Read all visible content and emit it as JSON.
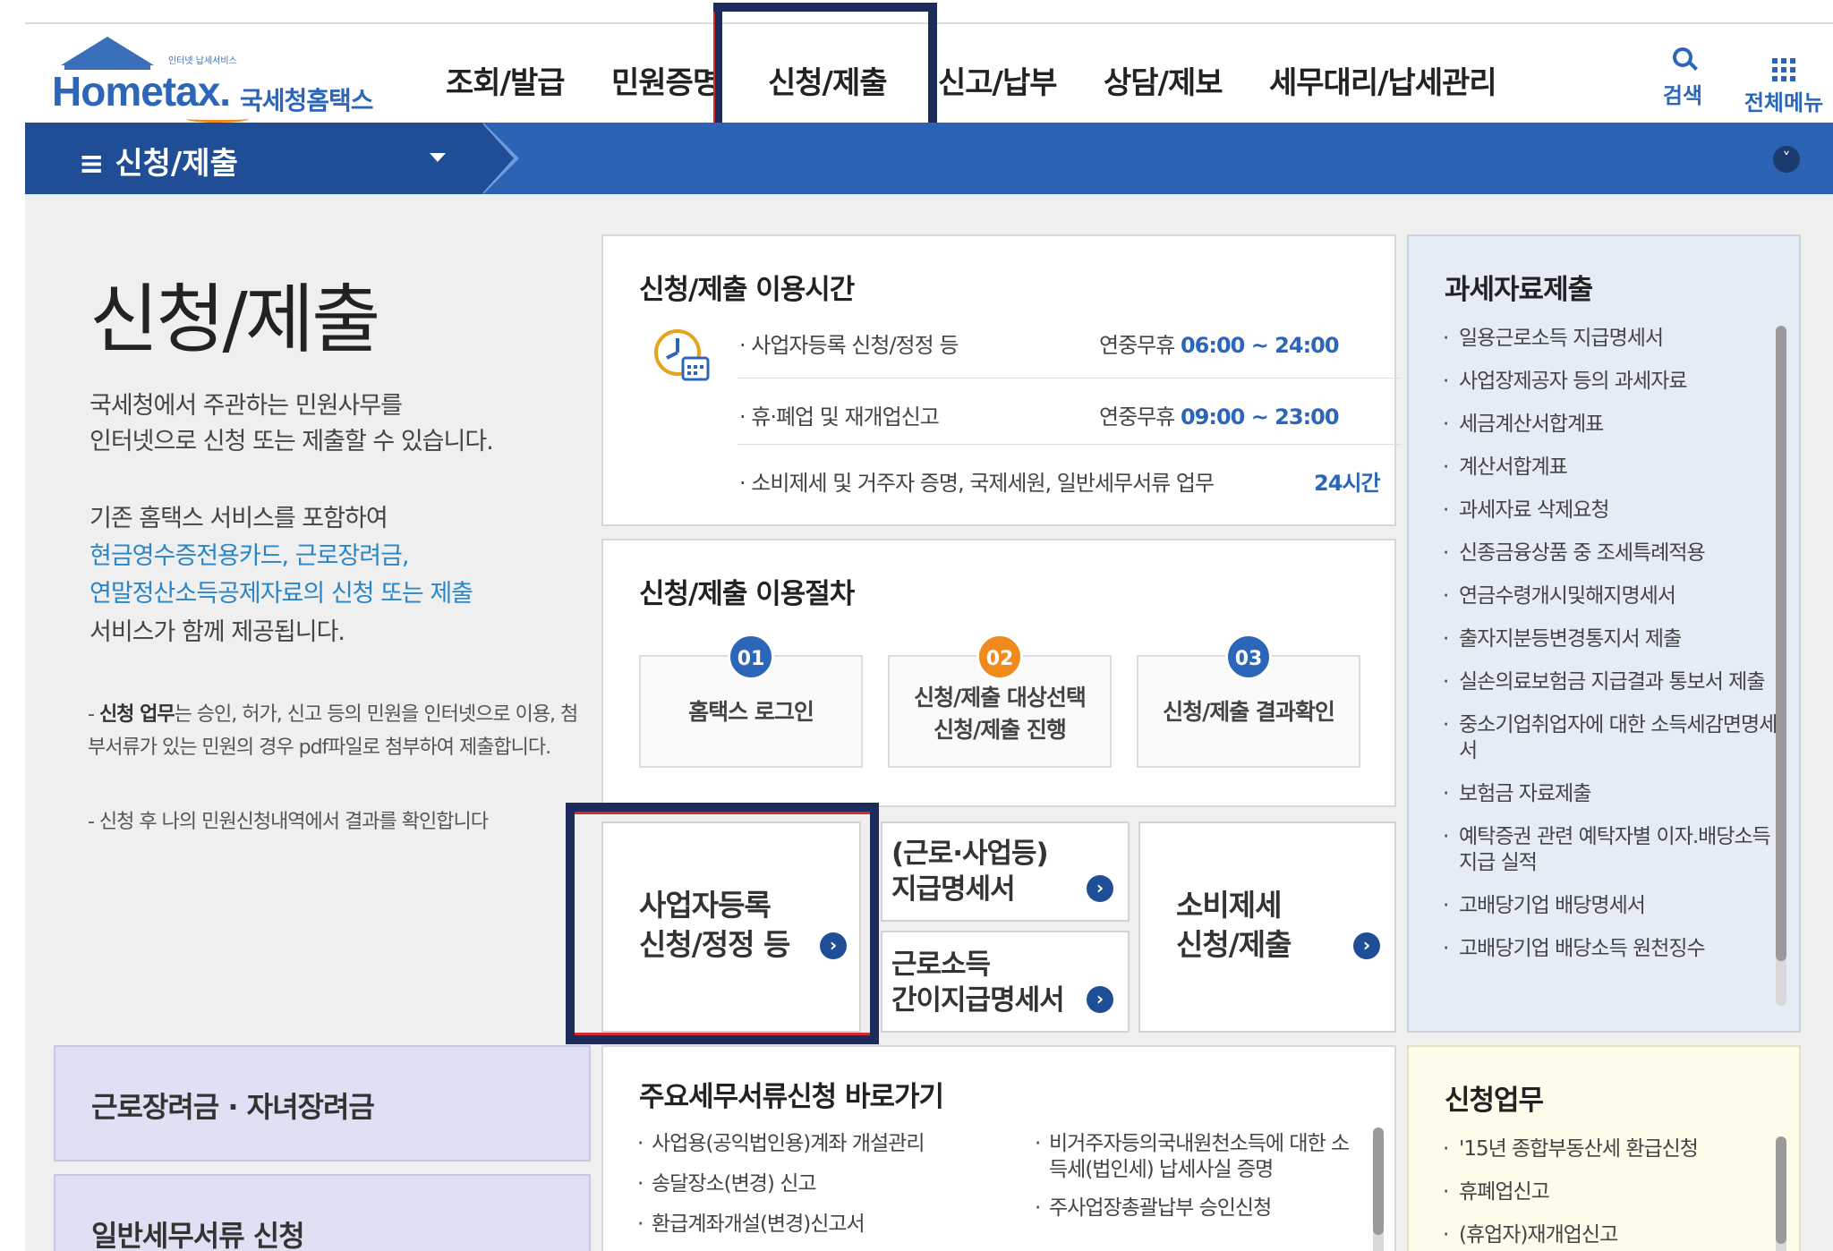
{
  "header": {
    "logo": {
      "tagline": "인터넷 납세서비스",
      "wordmark": "Hometax.",
      "korean": "국세청홈택스"
    },
    "nav": [
      "조회/발급",
      "민원증명",
      "신청/제출",
      "신고/납부",
      "상담/제보",
      "세무대리/납세관리"
    ],
    "tools": {
      "search_label": "검색",
      "allmenu_label": "전체메뉴"
    }
  },
  "subbar": {
    "title": "≡  신청/제출"
  },
  "intro": {
    "title": "신청/제출",
    "desc1": "국세청에서 주관하는 민원사무를",
    "desc2": "인터넷으로 신청 또는 제출할 수 있습니다.",
    "desc3": "기존 홈택스 서비스를 포함하여",
    "link1": "현금영수증전용카드, 근로장려금,",
    "link2": "연말정산소득공제자료의 신청 또는 제출",
    "desc4": "서비스가 함께 제공됩니다.",
    "notice1_bold": "신청 업무",
    "notice1_rest": "는 승인, 허가, 신고 등의 민원을 인터넷으로 이용, 첨부서류가 있는 민원의 경우 pdf파일로 첨부하여 제출합니다.",
    "notice1_prefix": "- ",
    "notice2": "- 신청 후 나의 민원신청내역에서 결과를 확인합니다"
  },
  "hours": {
    "title": "신청/제출 이용시간",
    "rows": [
      {
        "label": "· 사업자등록 신청/정정 등",
        "prefix": "연중무휴 ",
        "time": "06:00 ~ 24:00"
      },
      {
        "label": "· 휴·폐업 및 재개업신고",
        "prefix": "연중무휴 ",
        "time": "09:00 ~ 23:00"
      },
      {
        "label": "· 소비제세 및 거주자 증명, 국제세원, 일반세무서류 업무",
        "prefix": "",
        "time": "24시간"
      }
    ]
  },
  "procedure": {
    "title": "신청/제출 이용절차",
    "steps": [
      {
        "num": "01",
        "line1": "홈택스 로그인",
        "line2": ""
      },
      {
        "num": "02",
        "line1": "신청/제출 대상선택",
        "line2": "신청/제출 진행"
      },
      {
        "num": "03",
        "line1": "신청/제출 결과확인",
        "line2": ""
      }
    ]
  },
  "tiles": {
    "biz_reg_1": "사업자등록",
    "biz_reg_2": "신청/정정 등",
    "payment_1": "(근로·사업등)",
    "payment_2": "지급명세서",
    "simple_1": "근로소득",
    "simple_2": "간이지급명세서",
    "excise_1": "소비제세",
    "excise_2": "신청/제출",
    "go": "›"
  },
  "tax_data": {
    "title": "과세자료제출",
    "items": [
      "일용근로소득 지급명세서",
      "사업장제공자 등의 과세자료",
      "세금계산서합계표",
      "계산서합계표",
      "과세자료 삭제요청",
      "신종금융상품 중 조세특례적용",
      "연금수령개시및해지명세서",
      "출자지분등변경통지서 제출",
      "실손의료보험금 지급결과 통보서 제출",
      "중소기업취업자에 대한 소득세감면명세서",
      "보험금 자료제출",
      "예탁증권 관련 예탁자별 이자.배당소득 지급 실적",
      "고배당기업 배당명세서",
      "고배당기업 배당소득 원천징수"
    ]
  },
  "left_boxes": {
    "eitc": "근로장려금 · 자녀장려금",
    "general": "일반세무서류 신청"
  },
  "shortcuts": {
    "title": "주요세무서류신청 바로가기",
    "col1": [
      "사업용(공익법인용)계좌 개설관리",
      "송달장소(변경) 신고",
      "환급계좌개설(변경)신고서"
    ],
    "col2": [
      "비거주자등의국내원천소득에 대한 소득세(법인세) 납세사실 증명",
      "주사업장총괄납부 승인신청"
    ]
  },
  "apply": {
    "title": "신청업무",
    "items": [
      "'15년 종합부동산세 환급신청",
      "휴폐업신고",
      "(휴업자)재개업신고"
    ]
  },
  "colors": {
    "brand_blue": "#2c62b3",
    "dark_blue": "#1f4d96",
    "step1": "#2b66b8",
    "step2": "#f08a1c",
    "step3": "#2b66b8",
    "highlight": "#1c2a5c"
  }
}
